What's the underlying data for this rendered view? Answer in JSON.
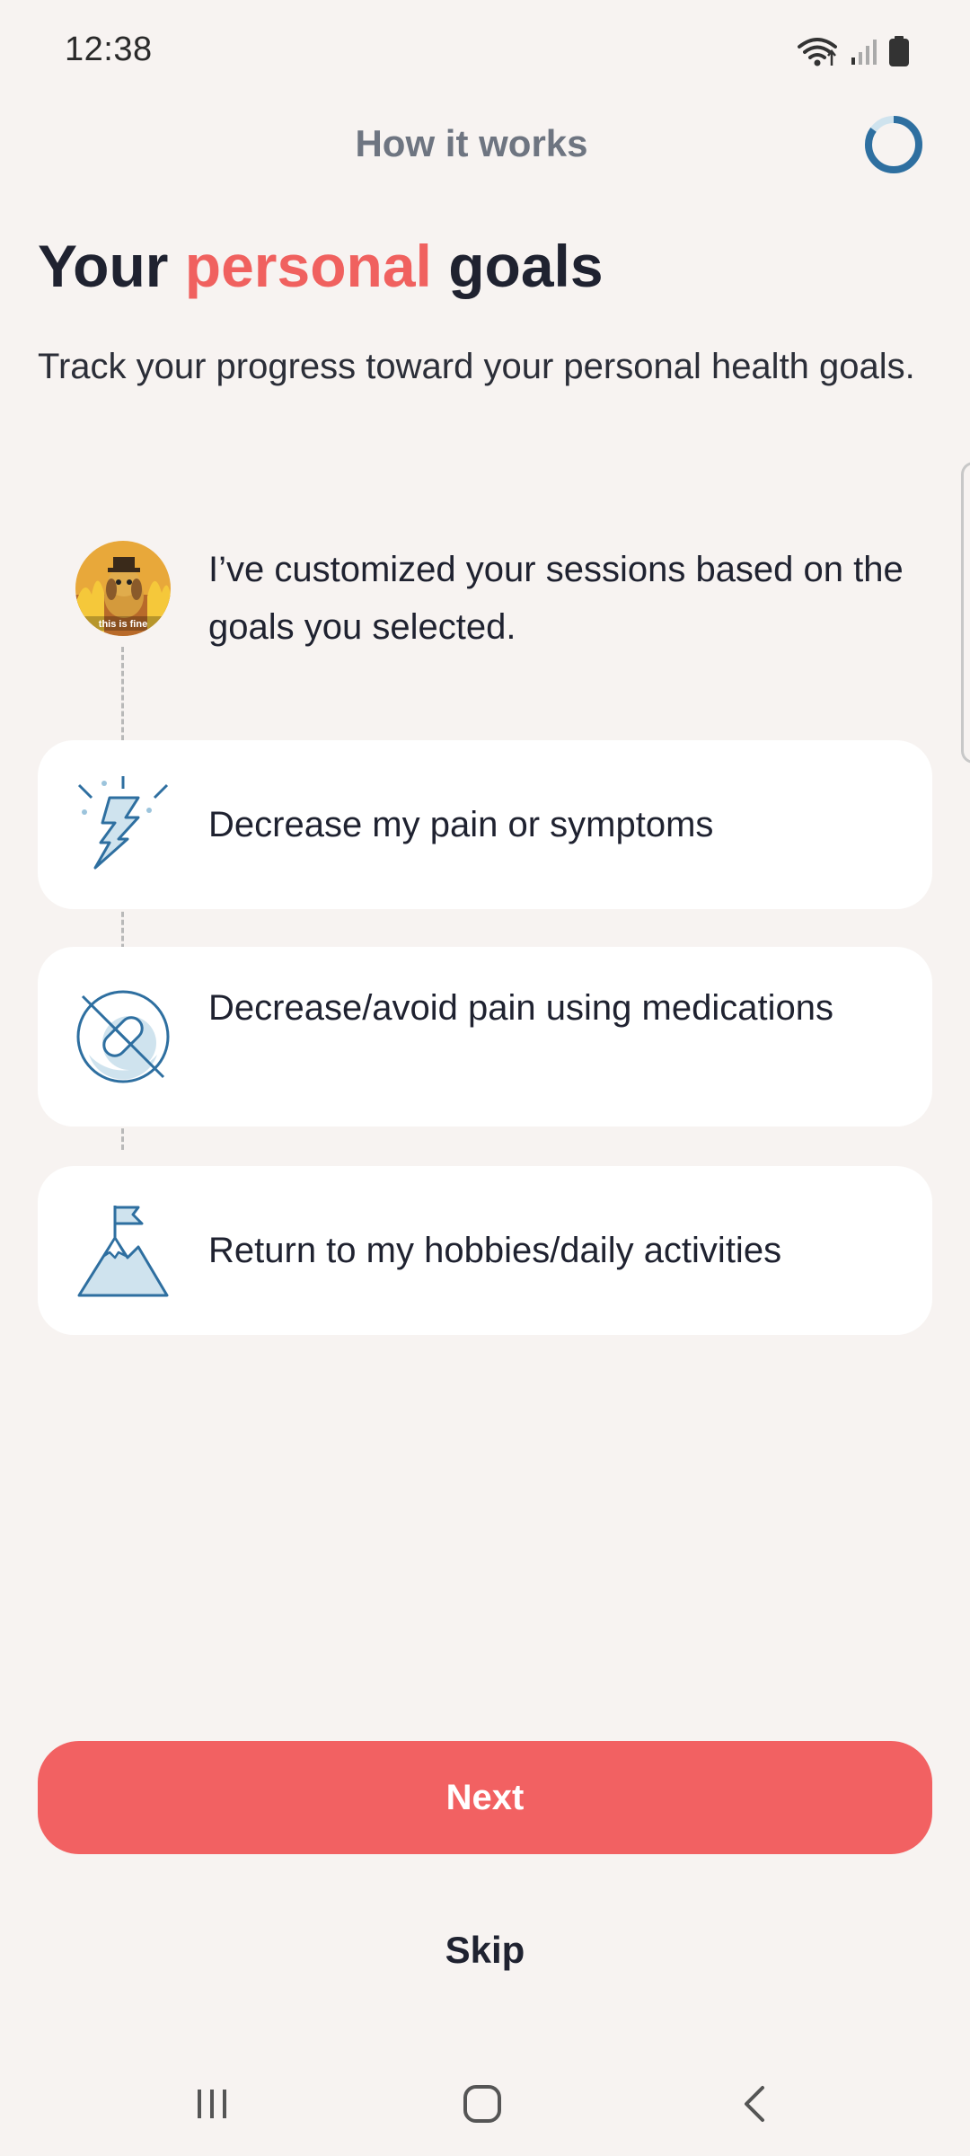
{
  "status_bar": {
    "time": "12:38"
  },
  "header": {
    "title": "How it works",
    "progress": 0.85
  },
  "heading": {
    "part1": "Your ",
    "accent": "personal",
    "part2": " goals"
  },
  "subtitle": "Track your progress toward your personal health goals.",
  "intro": {
    "avatar_caption": "this is fine",
    "message": "I’ve customized your sessions based on the goals you selected."
  },
  "goals": [
    {
      "label": "Decrease my pain or symptoms",
      "icon": "lightning-icon"
    },
    {
      "label": "Decrease/avoid pain using medications",
      "icon": "no-pill-icon"
    },
    {
      "label": "Return to my hobbies/daily activities",
      "icon": "mountain-flag-icon"
    }
  ],
  "actions": {
    "next_label": "Next",
    "skip_label": "Skip"
  },
  "colors": {
    "accent": "#f0615f",
    "button": "#f26162",
    "icon_stroke": "#2e6fa0",
    "icon_fill": "#cfe3ee",
    "background": "#f7f3f1"
  }
}
